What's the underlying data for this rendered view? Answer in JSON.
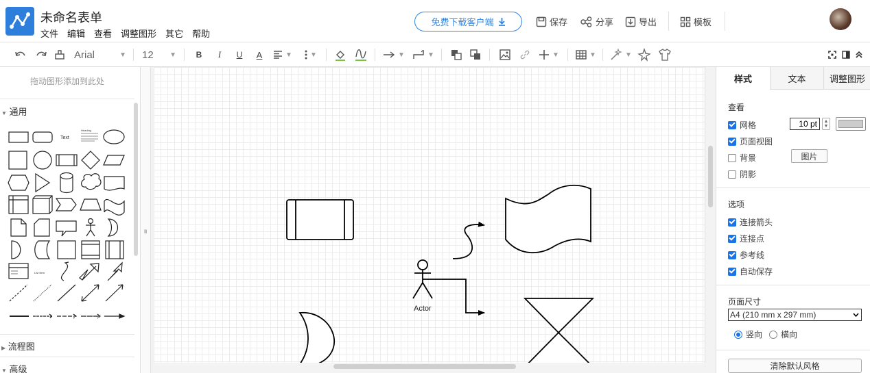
{
  "header": {
    "doc_title": "未命名表单",
    "menu": [
      "文件",
      "编辑",
      "查看",
      "调整图形",
      "其它",
      "帮助"
    ],
    "download_label": "免费下载客户端",
    "save_label": "保存",
    "share_label": "分享",
    "export_label": "导出",
    "template_label": "模板"
  },
  "toolbar": {
    "font_family": "Arial",
    "font_size": "12"
  },
  "left_panel": {
    "drag_hint": "拖动图形添加到此处",
    "sections": [
      "通用",
      "流程图",
      "高级"
    ],
    "shape_text_label": "Text",
    "shape_heading_label": "Heading",
    "shape_list_label": "List Item"
  },
  "canvas": {
    "actor_label": "Actor"
  },
  "right_panel": {
    "tabs": [
      "样式",
      "文本",
      "调整图形"
    ],
    "view_section": "查看",
    "grid_label": "网格",
    "grid_size": "10 pt",
    "page_view_label": "页面视图",
    "background_label": "背景",
    "image_button": "图片",
    "shadow_label": "阴影",
    "options_section": "选项",
    "connect_arrows_label": "连接箭头",
    "connect_points_label": "连接点",
    "guides_label": "参考线",
    "autosave_label": "自动保存",
    "page_size_section": "页面尺寸",
    "page_size_value": "A4 (210 mm x 297 mm)",
    "portrait_label": "竖向",
    "landscape_label": "横向",
    "reset_style_button": "清除默认风格",
    "grid_checked": true,
    "page_view_checked": true,
    "background_checked": false,
    "shadow_checked": false,
    "connect_arrows_checked": true,
    "connect_points_checked": true,
    "guides_checked": true,
    "autosave_checked": true,
    "orientation": "portrait",
    "accent_color": "#1a73e8",
    "grid_color_swatch": "#cccccc"
  }
}
